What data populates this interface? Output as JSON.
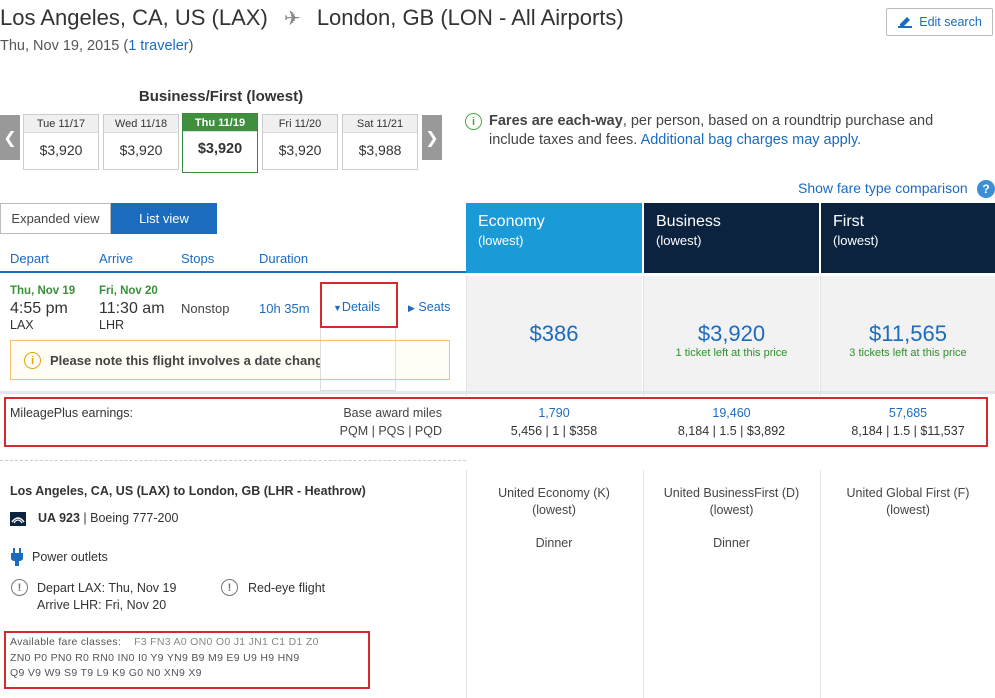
{
  "header": {
    "origin": "Los Angeles, CA, US (LAX)",
    "destination": "London, GB (LON - All Airports)",
    "date": "Thu, Nov 19, 2015",
    "travelers": "1 traveler",
    "edit_search": "Edit search",
    "icons": {
      "plane": "plane-icon",
      "edit": "pencil-icon"
    }
  },
  "calendar": {
    "title": "Business/First (lowest)",
    "days": [
      {
        "label": "Tue 11/17",
        "price": "$3,920"
      },
      {
        "label": "Wed 11/18",
        "price": "$3,920"
      },
      {
        "label": "Thu 11/19",
        "price": "$3,920",
        "selected": true
      },
      {
        "label": "Fri 11/20",
        "price": "$3,920"
      },
      {
        "label": "Sat 11/21",
        "price": "$3,988"
      }
    ]
  },
  "fare_note": {
    "bold": "Fares are each-way",
    "text": ", per person, based on a roundtrip purchase and include taxes and fees.",
    "link": "Additional bag charges may apply."
  },
  "show_comparison": "Show fare type comparison",
  "views": {
    "expanded": "Expanded view",
    "list": "List view"
  },
  "columns": {
    "depart": "Depart",
    "arrive": "Arrive",
    "stops": "Stops",
    "duration": "Duration"
  },
  "cabins": [
    {
      "name": "Economy",
      "sub": "(lowest)",
      "price": "$386",
      "note": "",
      "color": "#1a9ad6"
    },
    {
      "name": "Business",
      "sub": "(lowest)",
      "price": "$3,920",
      "note": "1 ticket left at this price",
      "color": "#0c2340"
    },
    {
      "name": "First",
      "sub": "(lowest)",
      "price": "$11,565",
      "note": "3 tickets left at this price",
      "color": "#0c2340"
    }
  ],
  "flight": {
    "depart_date": "Thu, Nov 19",
    "depart_time": "4:55 pm",
    "depart_airport": "LAX",
    "arrive_date": "Fri, Nov 20",
    "arrive_time": "11:30 am",
    "arrive_airport": "LHR",
    "stops": "Nonstop",
    "duration": "10h 35m",
    "details": "Details",
    "seats": "Seats",
    "notice": "Please note this flight involves a date change."
  },
  "mileage": {
    "label": "MileagePlus earnings:",
    "right_top": "Base award miles",
    "right_bot": "PQM | PQS | PQD",
    "values": [
      {
        "miles": "1,790",
        "detail": "5,456 | 1 | $358"
      },
      {
        "miles": "19,460",
        "detail": "8,184 | 1.5 | $3,892"
      },
      {
        "miles": "57,685",
        "detail": "8,184 | 1.5 | $11,537"
      }
    ]
  },
  "segment": {
    "title": "Los Angeles, CA, US (LAX) to London, GB (LHR - Heathrow)",
    "flight_no": "UA 923",
    "aircraft": "Boeing 777-200",
    "power": "Power outlets",
    "depart": "Depart LAX: Thu, Nov 19",
    "arrive": "Arrive LHR: Fri, Nov 20",
    "redeye": "Red-eye flight",
    "fare_label": "Available fare classes:",
    "fare_line1": "F3  FN3  A0  ON0  O0  J1  JN1  C1  D1  Z0",
    "fare_line2": "ZN0  P0  PN0  R0  RN0  IN0  I0  Y9  YN9  B9  M9  E9  U9  H9  HN9",
    "fare_line3": "Q9  V9  W9  S9  T9  L9  K9  G0  N0  XN9  X9",
    "cabins": [
      {
        "product": "United Economy (K)",
        "sub": "(lowest)",
        "meal": "Dinner"
      },
      {
        "product": "United BusinessFirst (D)",
        "sub": "(lowest)",
        "meal": "Dinner"
      },
      {
        "product": "United Global First (F)",
        "sub": "(lowest)",
        "meal": ""
      }
    ]
  }
}
